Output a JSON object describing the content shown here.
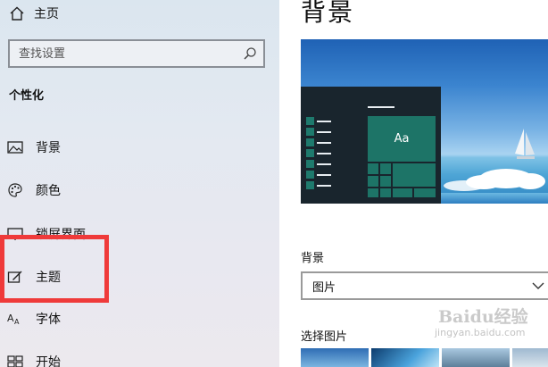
{
  "sidebar": {
    "home_label": "主页",
    "search_placeholder": "查找设置",
    "section_title": "个性化",
    "items": [
      {
        "label": "背景",
        "icon": "picture-icon"
      },
      {
        "label": "颜色",
        "icon": "palette-icon"
      },
      {
        "label": "锁屏界面",
        "icon": "monitor-icon"
      },
      {
        "label": "主题",
        "icon": "theme-brush-icon"
      },
      {
        "label": "字体",
        "icon": "font-icon"
      },
      {
        "label": "开始",
        "icon": "start-icon"
      }
    ]
  },
  "main": {
    "page_title": "背景",
    "preview_tile_text": "Aa",
    "background_label": "背景",
    "background_value": "图片",
    "choose_picture_label": "选择图片"
  },
  "watermark": {
    "text": "Baidu经验",
    "sub": "jingyan.baidu.com"
  },
  "colors": {
    "highlight": "#ef3a3a",
    "tile": "#1d7467",
    "start_menu": "#19252d"
  }
}
